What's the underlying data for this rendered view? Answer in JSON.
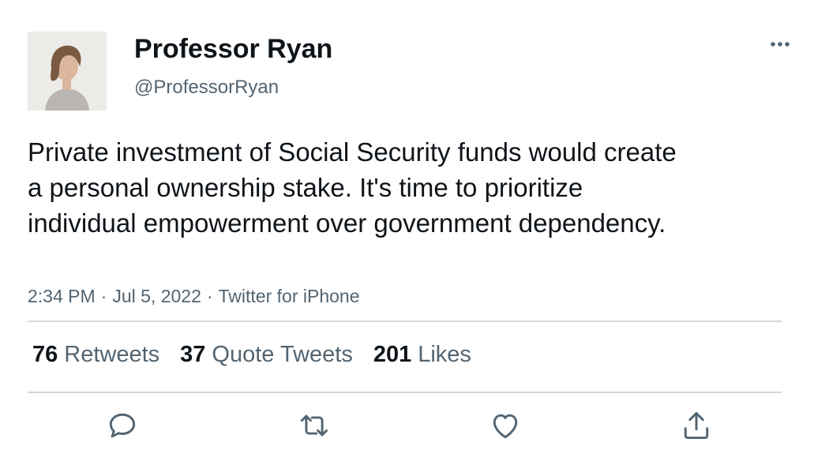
{
  "author": {
    "display_name": "Professor Ryan",
    "handle": "@ProfessorRyan"
  },
  "tweet": {
    "text": "Private investment of Social Security funds would create a personal ownership stake. It's time to prioritize individual empowerment over government dependency.",
    "time": "2:34 PM",
    "separator": "·",
    "date": "Jul 5, 2022",
    "source": "Twitter for iPhone"
  },
  "stats": {
    "retweets": {
      "count": "76",
      "label": "Retweets"
    },
    "quote_tweets": {
      "count": "37",
      "label": "Quote Tweets"
    },
    "likes": {
      "count": "201",
      "label": "Likes"
    }
  },
  "actions": [
    "reply-icon",
    "retweet-icon",
    "like-icon",
    "share-icon"
  ],
  "colors": {
    "text_primary": "#0f1419",
    "text_secondary": "#536471",
    "divider": "#cfd9de",
    "icon": "#536471"
  }
}
